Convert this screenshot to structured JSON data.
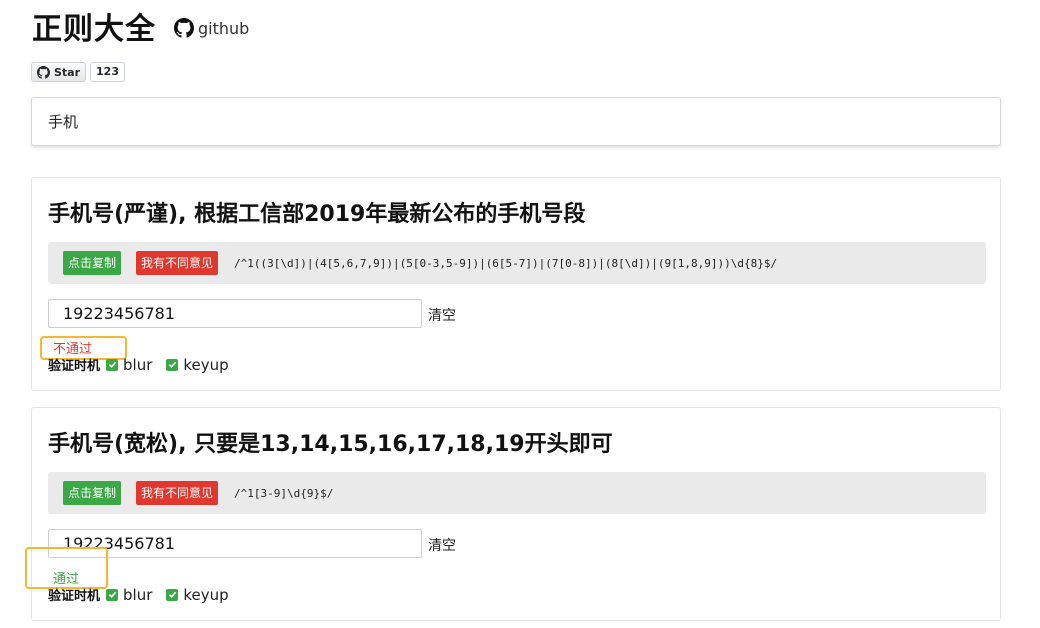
{
  "header": {
    "title": "正则大全",
    "github_label": "github"
  },
  "star_widget": {
    "star_label": "Star",
    "count": "123"
  },
  "search": {
    "value": "手机",
    "placeholder": ""
  },
  "cards": [
    {
      "title": "手机号(严谨), 根据工信部2019年最新公布的手机号段",
      "copy_label": "点击复制",
      "diff_label": "我有不同意见",
      "regex": "/^1((3[\\d])|(4[5,6,7,9])|(5[0-3,5-9])|(6[5-7])|(7[0-8])|(8[\\d])|(9[1,8,9]))\\d{8}$/",
      "test_value": "19223456781",
      "clear_label": "清空",
      "result": "不通过",
      "result_status": "fail",
      "timing_label": "验证时机",
      "options": [
        {
          "label": "blur",
          "checked": true
        },
        {
          "label": "keyup",
          "checked": true
        }
      ]
    },
    {
      "title": "手机号(宽松), 只要是13,14,15,16,17,18,19开头即可",
      "copy_label": "点击复制",
      "diff_label": "我有不同意见",
      "regex": "/^1[3-9]\\d{9}$/",
      "test_value": "19223456781",
      "clear_label": "清空",
      "result": "通过",
      "result_status": "pass",
      "timing_label": "验证时机",
      "options": [
        {
          "label": "blur",
          "checked": true
        },
        {
          "label": "keyup",
          "checked": true
        }
      ]
    }
  ],
  "colors": {
    "pass": "#3aa845",
    "fail": "#e03a2e",
    "highlight": "#f5b731"
  }
}
